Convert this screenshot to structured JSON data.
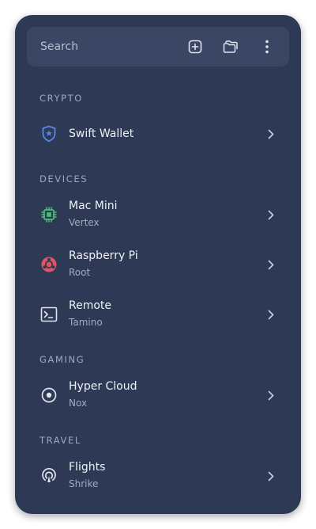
{
  "search": {
    "placeholder": "Search",
    "actions": [
      {
        "name": "add-item",
        "icon": "plus-square-icon"
      },
      {
        "name": "folders",
        "icon": "folders-icon"
      },
      {
        "name": "more",
        "icon": "vertical-dots-icon"
      }
    ]
  },
  "colors": {
    "panel": "#2e3a55",
    "search_bg": "#3a4663",
    "section_text": "#9ea8bd",
    "accent_blue": "#5b86e5",
    "accent_green": "#4bbf73",
    "accent_red": "#e05561"
  },
  "sections": [
    {
      "header": "CRYPTO",
      "items": [
        {
          "title": "Swift Wallet",
          "subtitle": "",
          "icon": "shield-star-icon"
        }
      ]
    },
    {
      "header": "DEVICES",
      "items": [
        {
          "title": "Mac Mini",
          "subtitle": "Vertex",
          "icon": "chip-icon"
        },
        {
          "title": "Raspberry Pi",
          "subtitle": "Root",
          "icon": "raspberry-pi-icon"
        },
        {
          "title": "Remote",
          "subtitle": "Tamino",
          "icon": "terminal-icon"
        }
      ]
    },
    {
      "header": "GAMING",
      "items": [
        {
          "title": "Hyper Cloud",
          "subtitle": "Nox",
          "icon": "target-icon"
        }
      ]
    },
    {
      "header": "TRAVEL",
      "items": [
        {
          "title": "Flights",
          "subtitle": "Shrike",
          "icon": "podcast-icon"
        }
      ]
    }
  ]
}
